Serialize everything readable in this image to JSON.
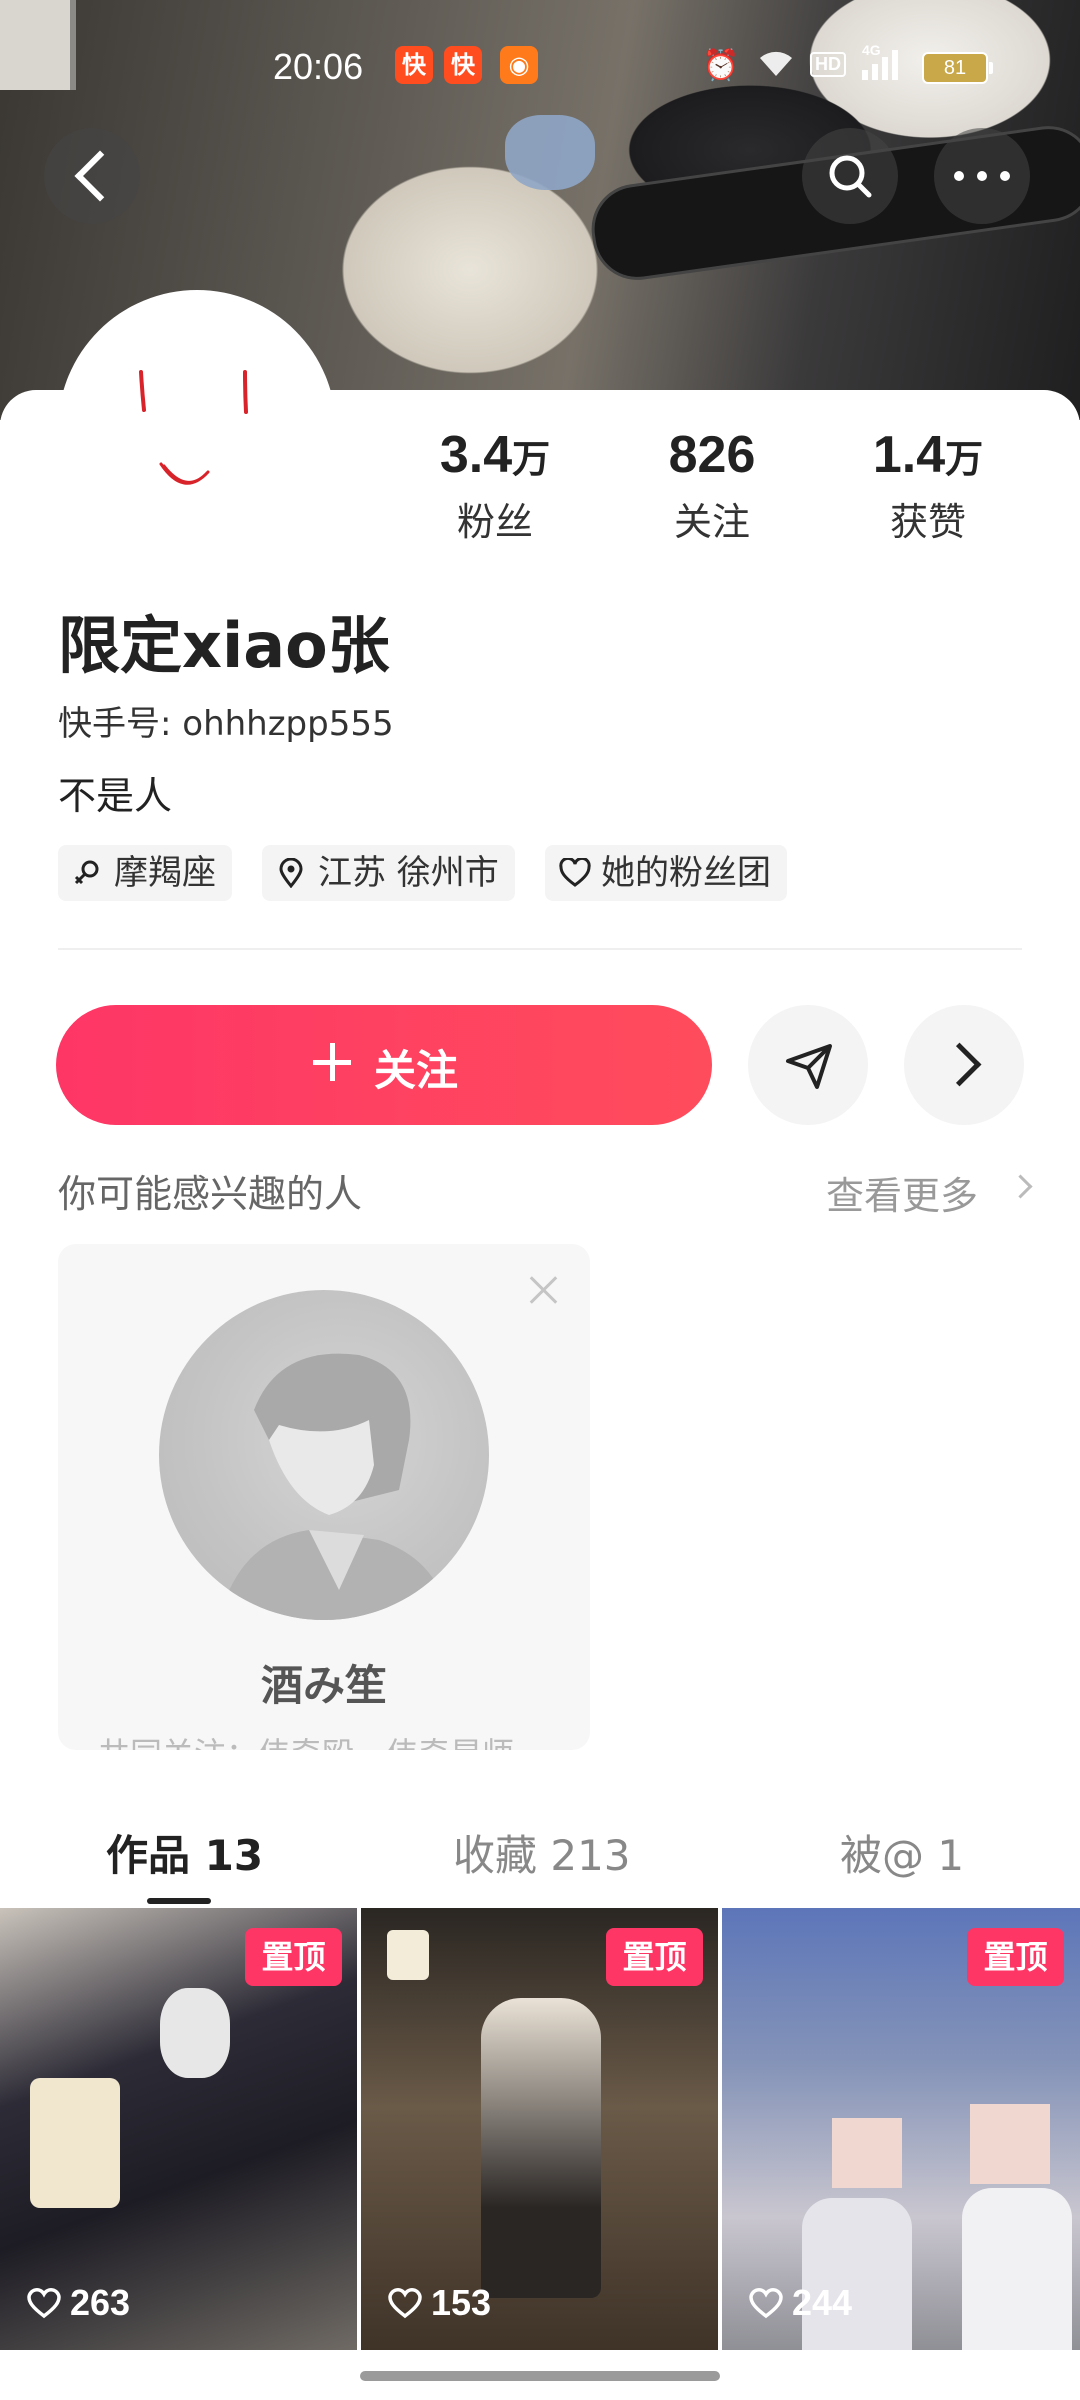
{
  "status_bar": {
    "time": "20:06",
    "battery": "81",
    "network": "4G",
    "hd": "HD"
  },
  "profile": {
    "name": "限定xiao张",
    "kuaishou_id": "快手号: ohhhzpp555",
    "bio": "不是人",
    "stats": [
      {
        "num": "3.4",
        "unit": "万",
        "label": "粉丝"
      },
      {
        "num": "826",
        "unit": "",
        "label": "关注"
      },
      {
        "num": "1.4",
        "unit": "万",
        "label": "获赞"
      }
    ],
    "tags": [
      "摩羯座",
      "江苏 徐州市",
      "她的粉丝团"
    ]
  },
  "actions": {
    "follow_label": "关注"
  },
  "suggestions": {
    "title": "你可能感兴趣的人",
    "see_more": "查看更多",
    "card": {
      "name": "酒み笙",
      "mutual": "共同关注：伟奇殴，伟奇昂师"
    }
  },
  "tabs": [
    {
      "label": "作品 13",
      "active": true
    },
    {
      "label": "收藏 213",
      "active": false
    },
    {
      "label": "被@ 1",
      "active": false
    }
  ],
  "videos": [
    {
      "pinned": "置顶",
      "likes": "263"
    },
    {
      "pinned": "置顶",
      "likes": "153"
    },
    {
      "pinned": "置顶",
      "likes": "244"
    }
  ],
  "colors": {
    "accent": "#fe3666",
    "text": "#222222",
    "muted": "#999999"
  }
}
